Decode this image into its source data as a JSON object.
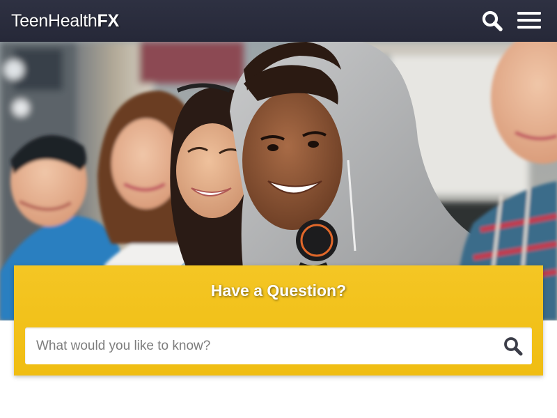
{
  "header": {
    "logo_light": "TeenHealth",
    "logo_bold": "FX",
    "search_icon": "search-icon",
    "menu_icon": "hamburger-menu-icon"
  },
  "hero": {
    "image": "group of smiling teenagers sitting together outdoors"
  },
  "question": {
    "title": "Have a Question?",
    "placeholder": "What would you like to know?",
    "submit_icon": "search-icon"
  },
  "colors": {
    "header_bg": "#2a2c3d",
    "panel_yellow": "#f2c11a",
    "white": "#ffffff",
    "icon_gray": "#3b3d48"
  }
}
